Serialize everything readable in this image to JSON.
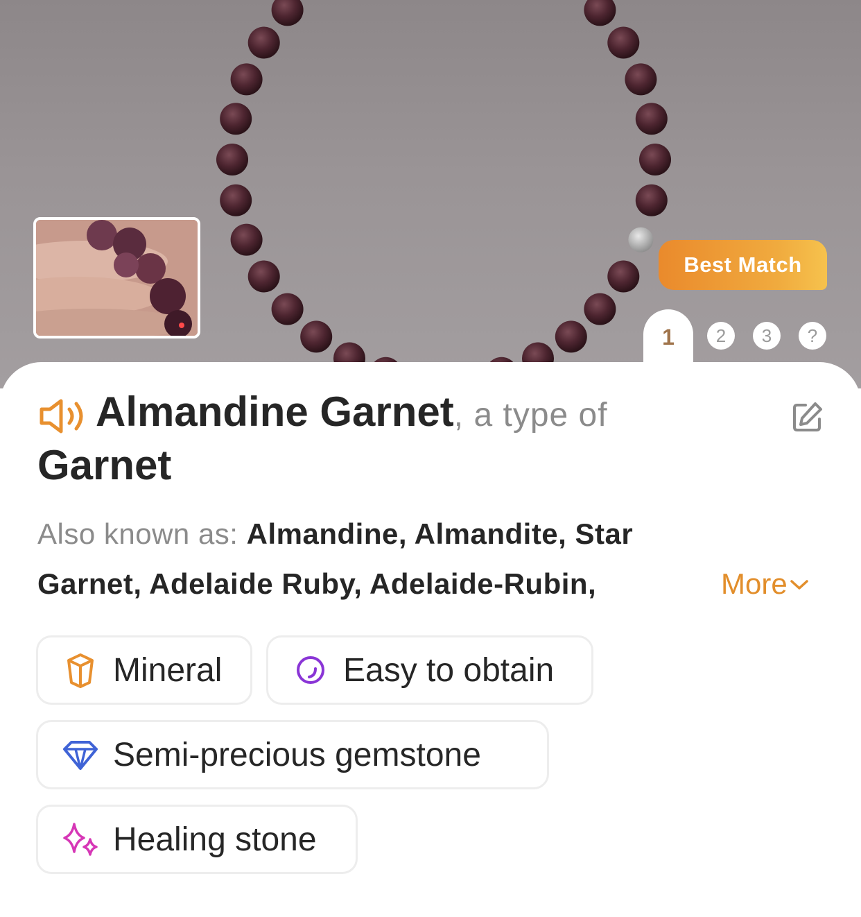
{
  "result": {
    "badge": "Best Match",
    "pages": {
      "active": "1",
      "others": [
        "2",
        "3",
        "?"
      ]
    }
  },
  "stone": {
    "name": "Almandine Garnet",
    "type_prefix": ", a type of",
    "parent": "Garnet"
  },
  "aka": {
    "label": "Also known as:",
    "names": "Almandine, Almandite, Star Garnet, Adelaide Ruby, Adelaide-Rubin,",
    "more_label": "More"
  },
  "tags": [
    {
      "label": "Mineral",
      "icon": "mineral-icon",
      "color": "#e8902f"
    },
    {
      "label": "Easy to obtain",
      "icon": "easy-obtain-icon",
      "color": "#8a35d6"
    },
    {
      "label": "Semi-precious gemstone",
      "icon": "gem-icon",
      "color": "#3f63d6"
    },
    {
      "label": "Healing stone",
      "icon": "sparkle-icon",
      "color": "#d637b6"
    }
  ],
  "colors": {
    "accent": "#e28e2b",
    "text": "#262626",
    "muted": "#8b8b8b"
  }
}
